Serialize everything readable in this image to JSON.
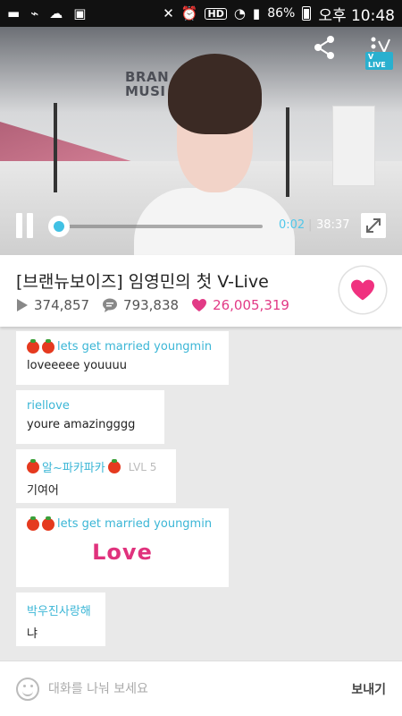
{
  "statusbar": {
    "battery": "86%",
    "clock": "오후 10:48",
    "hd": "HD"
  },
  "video": {
    "background_text": "BRAN\nMUSI",
    "logo_text": "V LIVE",
    "current_time": "0:02",
    "separator": "|",
    "total_time": "38:37",
    "progress": 0.001
  },
  "info": {
    "title": "[브랜뉴보이즈] 임영민의 첫 V-Live",
    "views": "374,857",
    "comments": "793,838",
    "likes": "26,005,319",
    "accent_color": "#e23a86"
  },
  "chat": {
    "messages": [
      {
        "name": "lets get married youngmin",
        "text": "loveeeee youuuu"
      },
      {
        "name": "riellove",
        "text": "youre amazingggg"
      },
      {
        "name": "알~파카파카",
        "level": "LVL 5",
        "text": "기여어"
      },
      {
        "name": "lets get married youngmin",
        "sticker": "Love"
      },
      {
        "name": "박우진사랑해",
        "text": "냐"
      }
    ]
  },
  "input": {
    "placeholder": "대화를 나눠 보세요",
    "send_label": "보내기"
  }
}
